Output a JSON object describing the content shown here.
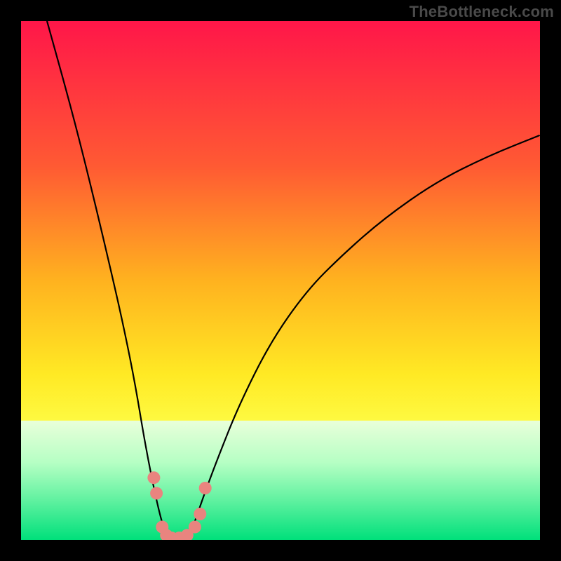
{
  "watermark": "TheBottleneck.com",
  "chart_data": {
    "type": "line",
    "title": "",
    "xlabel": "",
    "ylabel": "",
    "xlim": [
      0,
      100
    ],
    "ylim": [
      0,
      100
    ],
    "series": [
      {
        "name": "bottleneck-curve",
        "x": [
          5,
          10,
          14,
          18,
          20,
          22,
          24,
          26,
          27.5,
          29,
          31,
          33,
          35,
          38,
          42,
          48,
          55,
          62,
          70,
          80,
          90,
          100
        ],
        "values": [
          100,
          82,
          66,
          49,
          40,
          30,
          18,
          8,
          2,
          0,
          0,
          2,
          8,
          16,
          26,
          38,
          48,
          55,
          62,
          69,
          74,
          78
        ]
      }
    ],
    "markers": {
      "name": "highlight-dots",
      "color": "#e9847f",
      "points": [
        {
          "x": 25.6,
          "y": 12
        },
        {
          "x": 26.1,
          "y": 9
        },
        {
          "x": 27.2,
          "y": 2.5
        },
        {
          "x": 28.0,
          "y": 0.9
        },
        {
          "x": 29.0,
          "y": 0.4
        },
        {
          "x": 30.5,
          "y": 0.4
        },
        {
          "x": 32.0,
          "y": 0.9
        },
        {
          "x": 33.5,
          "y": 2.5
        },
        {
          "x": 34.5,
          "y": 5
        },
        {
          "x": 35.5,
          "y": 10
        }
      ]
    },
    "background_gradient": {
      "top": "#ff1649",
      "mid1": "#ff8b2a",
      "mid2": "#ffe924",
      "low": "#faff8d",
      "band_top": "#e8ffd9",
      "band_bottom": "#00e57a"
    },
    "green_band": {
      "y_start": 23,
      "y_end": 0
    }
  }
}
